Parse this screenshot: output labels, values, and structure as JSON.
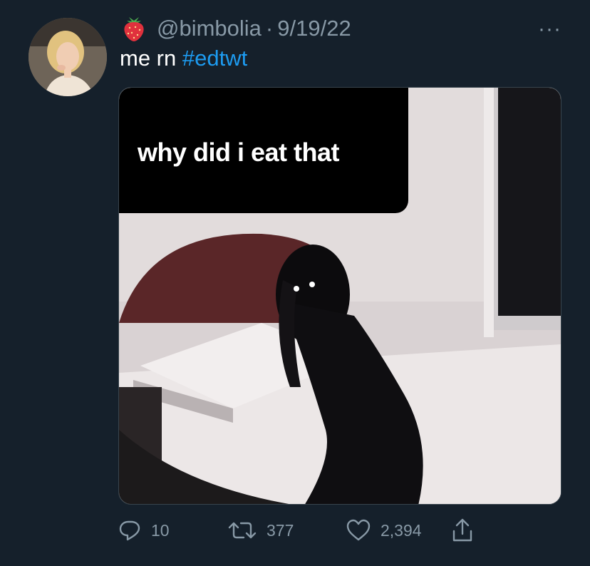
{
  "tweet": {
    "handle": "@bimbolia",
    "separator": "·",
    "date": "9/19/22",
    "text": "me rn ",
    "hashtag": "#edtwt",
    "more": "···"
  },
  "media": {
    "caption": "why did i eat that"
  },
  "actions": {
    "replies": "10",
    "retweets": "377",
    "likes": "2,394"
  },
  "icons": {
    "name_emoji": "strawberry-icon",
    "reply": "reply-icon",
    "retweet": "retweet-icon",
    "like": "heart-icon",
    "share": "share-icon"
  },
  "colors": {
    "background": "#15202b",
    "secondary_text": "#8899a6",
    "hashtag": "#1d9bf0"
  }
}
